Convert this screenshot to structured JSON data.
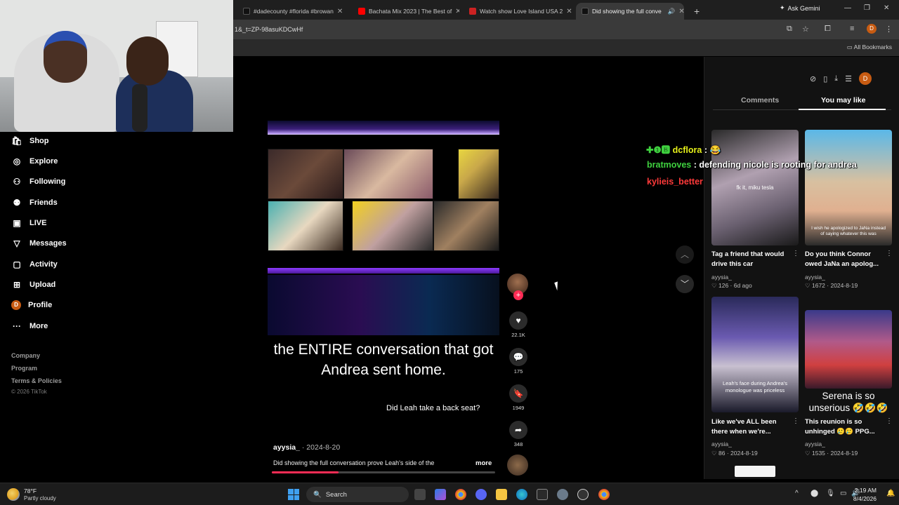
{
  "browser": {
    "tabs": [
      {
        "label": "#dadecounty #florida #browan",
        "favicon_color": "#111111"
      },
      {
        "label": "Bachata Mix 2023 | The Best of",
        "favicon_color": "#ff0000"
      },
      {
        "label": "Watch show Love Island USA 2",
        "favicon_color": "#cc2222"
      },
      {
        "label": "Did showing the full conve",
        "favicon_color": "#111111"
      }
    ],
    "new_tab": "+",
    "ask_gemini": "Ask Gemini",
    "url": "1&_t=ZP-98asuKDCwHf",
    "profile_initial": "D",
    "all_bookmarks": "All Bookmarks"
  },
  "sidebar": {
    "items": [
      {
        "label": "Shop",
        "icon": "shop-icon"
      },
      {
        "label": "Explore",
        "icon": "compass-icon"
      },
      {
        "label": "Following",
        "icon": "following-icon"
      },
      {
        "label": "Friends",
        "icon": "friends-icon"
      },
      {
        "label": "LIVE",
        "icon": "live-icon"
      },
      {
        "label": "Messages",
        "icon": "messages-icon"
      },
      {
        "label": "Activity",
        "icon": "activity-icon"
      },
      {
        "label": "Upload",
        "icon": "upload-icon"
      },
      {
        "label": "Profile",
        "icon": "profile-icon"
      },
      {
        "label": "More",
        "icon": "more-icon"
      }
    ],
    "profile_initial": "D",
    "footer": [
      "Company",
      "Program",
      "Terms & Policies"
    ],
    "copyright": "© 2026 TikTok"
  },
  "video": {
    "caption": "the ENTIRE conversation that got Andrea sent home.",
    "sub_caption": "Did Leah take a back seat?",
    "author": "ayysia_",
    "date": " · 2024-8-20",
    "description": "Did showing the full conversation prove Leah's side of the",
    "more": "more",
    "progress": 0.3
  },
  "actions": {
    "follow": "+",
    "likes": "22.1K",
    "comments": "175",
    "saves": "1949",
    "shares": "348"
  },
  "right_panel": {
    "tabs": [
      "Comments",
      "You may like"
    ],
    "active_tab": "You may like",
    "profile_initial": "D",
    "cards": [
      {
        "title": "Tag a friend that would drive this car",
        "author": "ayysia_",
        "likes": "126",
        "date": "6d ago",
        "overlay": "fk it, miku tesla"
      },
      {
        "title": "Do you think Connor owed JaNa an apolog...",
        "author": "ayysia_",
        "likes": "1672",
        "date": "2024-8-19",
        "overlay": "I wish he apologized to JaNa instead of saying whatever this was"
      },
      {
        "title": "Like we've ALL been there when we're...",
        "author": "ayysia_",
        "likes": "86",
        "date": "2024-8-19",
        "overlay": "Leah's face during Andrea's monologue was priceless"
      },
      {
        "title": "This reunion is so unhinged 🥲🥲 PPG...",
        "author": "ayysia_",
        "likes": "1535",
        "date": "2024-8-19",
        "overlay": "Serena is so unserious 🤣🤣🤣"
      }
    ]
  },
  "chat": [
    {
      "user": "dcflora",
      "prefix": "✚❶🅱",
      "message": " : 😂",
      "color": "#e8f21a"
    },
    {
      "user": "bratmoves",
      "prefix": "",
      "message": " : defending nicole is rooting for andrea",
      "color": "#3fd13f"
    },
    {
      "user": "kylieis_better",
      "prefix": "",
      "message": "",
      "color": "#ff3a3a"
    }
  ],
  "taskbar": {
    "temp": "78°F",
    "weather": "Partly cloudy",
    "search": "Search",
    "time": "2:19 AM",
    "date": "8/4/2026"
  }
}
